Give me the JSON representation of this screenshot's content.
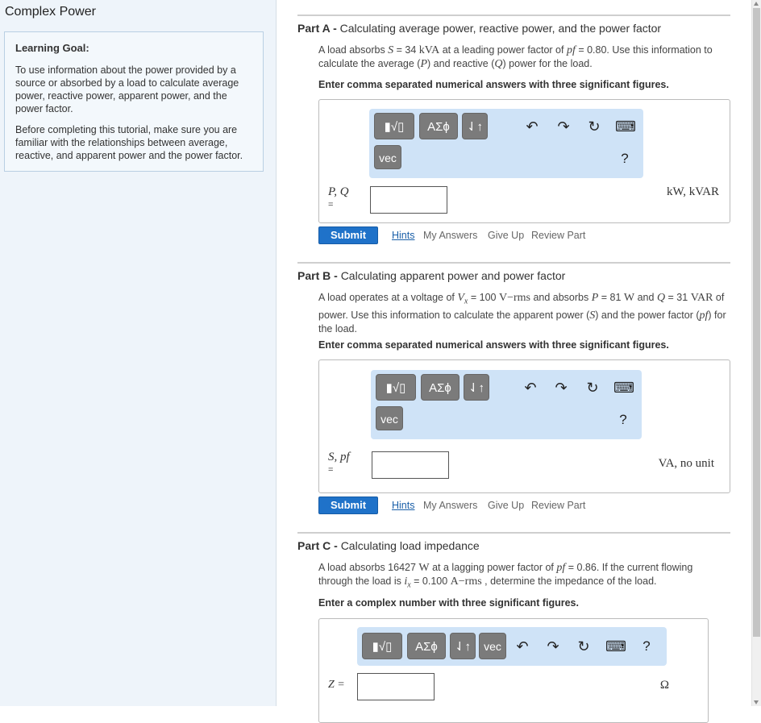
{
  "app": {
    "title": "Complex Power"
  },
  "goal": {
    "heading": "Learning Goal:",
    "p1": "To use information about the power provided by a source or absorbed by a load to calculate average power, reactive power, apparent power, and the power factor.",
    "p2": "Before completing this tutorial, make sure you are familiar with the relationships between average, reactive, and apparent power and the power factor."
  },
  "toolbar": {
    "templates_label": "▮√▯",
    "symbols_label": "ΑΣϕ",
    "arrows_label": "⇃↑",
    "vec_label": "vec",
    "undo": "↶",
    "redo": "↷",
    "reset": "↻",
    "keyboard": "⌨",
    "help": "?"
  },
  "actions": {
    "submit": "Submit",
    "hints": "Hints",
    "my_answers": "My Answers",
    "give_up": "Give Up",
    "review": "Review Part"
  },
  "parts": {
    "a": {
      "label": "Part A - ",
      "title": "Calculating average power, reactive power, and the power factor",
      "d1": "A load absorbs ",
      "d2": "S",
      "d3": " = 34 ",
      "d4": "kVA",
      "d5": " at a leading power factor of ",
      "d6": "pf",
      "d7": " = 0.80. Use this information to calculate the average (",
      "d8": "P",
      "d9": ") and reactive (",
      "d10": "Q",
      "d11": ") power for the load.",
      "instr": "Enter comma separated numerical answers with three significant figures.",
      "lhs": "P, Q",
      "eq": "=",
      "input_value": "",
      "units": "kW, kVAR"
    },
    "b": {
      "label": "Part B - ",
      "title": "Calculating apparent power and power factor",
      "d1": "A load operates at a voltage of ",
      "d2": "V",
      "d2s": "x",
      "d3": " = 100 ",
      "d4": "V−rms",
      "d5": " and absorbs ",
      "d6": "P",
      "d7": " = 81 ",
      "d8": "W",
      "d9": " and ",
      "d10": "Q",
      "d11": " = 31 ",
      "d12": "VAR",
      "d13": " of power. Use this information to calculate the apparent power (",
      "d14": "S",
      "d15": ") and the power factor (",
      "d16": "pf",
      "d17": ") for the load.",
      "instr": "Enter comma separated numerical answers with three significant figures.",
      "lhs": "S, pf",
      "eq": "=",
      "input_value": "",
      "units": "VA, no unit"
    },
    "c": {
      "label": "Part C - ",
      "title": "Calculating load impedance",
      "d1": "A load absorbs 16427 ",
      "d2": "W",
      "d3": "  at a lagging power factor of ",
      "d4": "pf",
      "d5": " = 0.86. If the current flowing through the load is ",
      "d6": "i",
      "d6s": "x",
      "d7": " = 0.100 ",
      "d8": "A−rms",
      "d9": " , determine the impedance of the load.",
      "instr": "Enter a complex number with three significant figures.",
      "lhs": "Z =",
      "input_value": "",
      "units": "Ω"
    }
  }
}
